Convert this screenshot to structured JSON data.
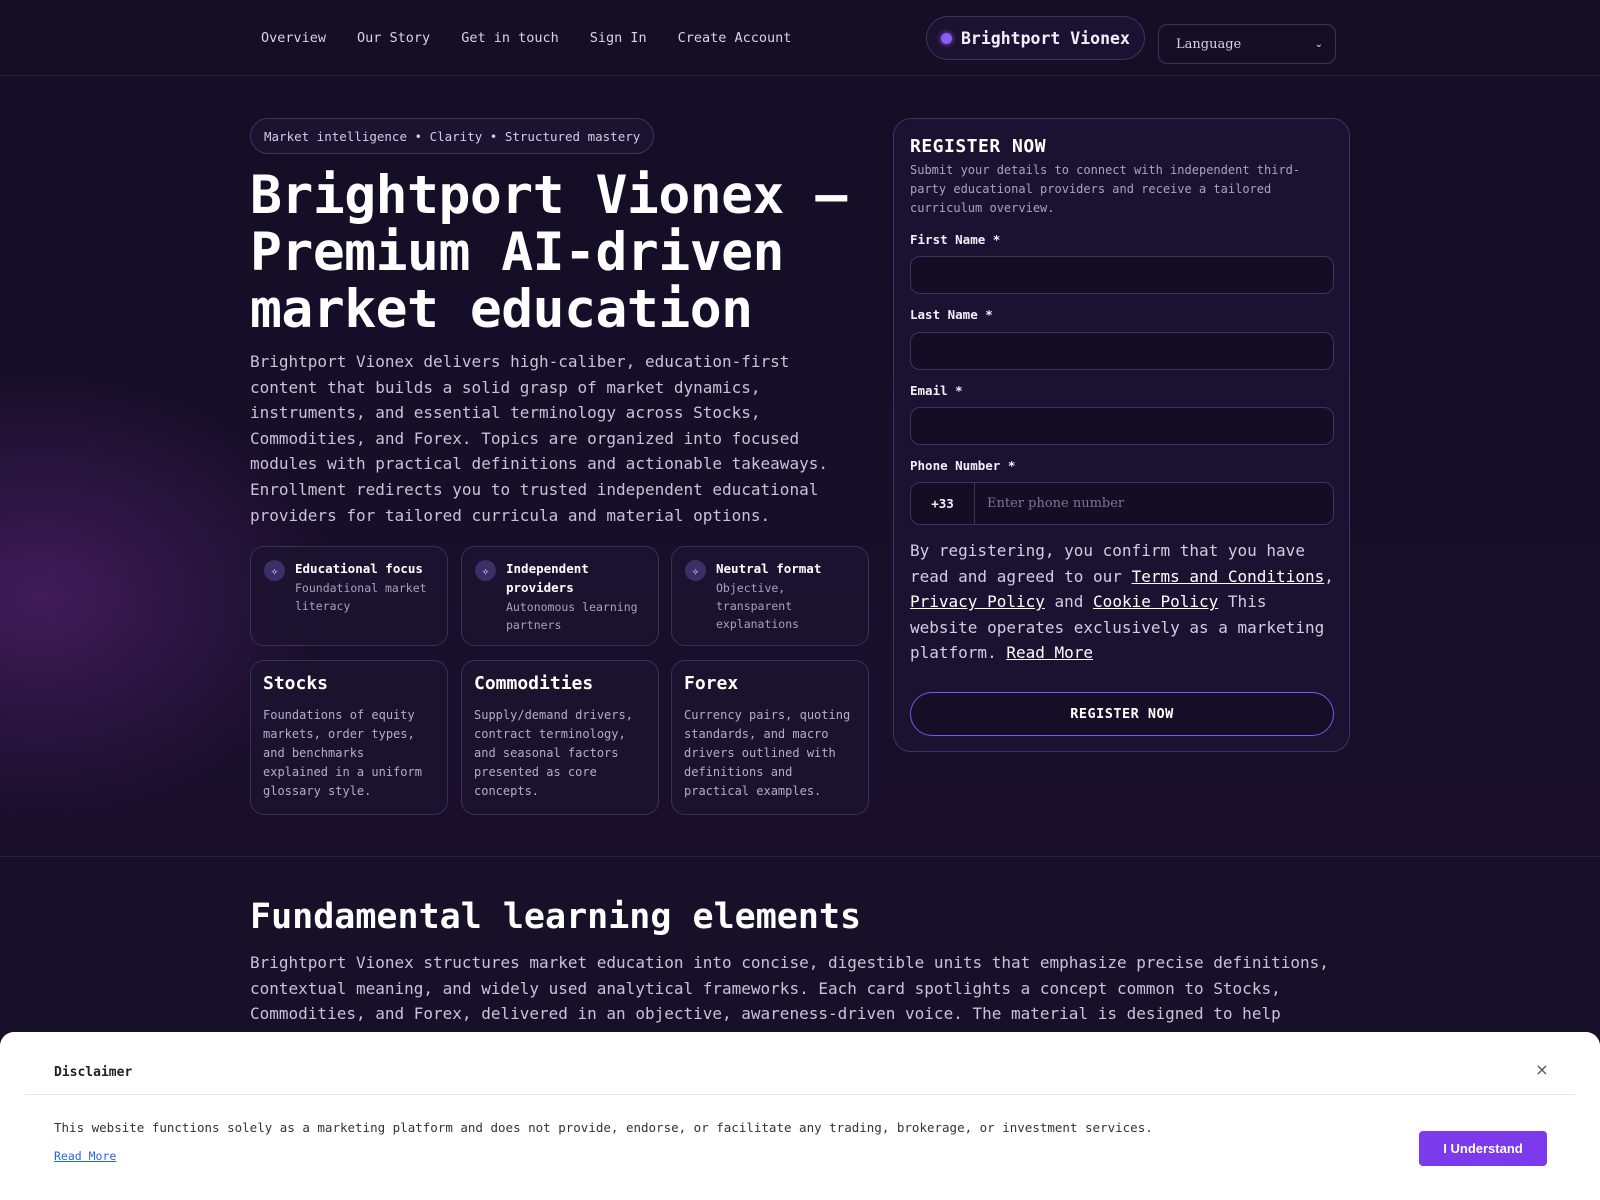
{
  "header": {
    "nav": [
      "Overview",
      "Our Story",
      "Get in touch",
      "Sign In",
      "Create Account"
    ],
    "brand": "Brightport Vionex",
    "language_label": "Language"
  },
  "hero": {
    "tagline": "Market intelligence • Clarity • Structured mastery",
    "title": "Brightport Vionex — Premium AI-driven market education",
    "description": "Brightport Vionex delivers high-caliber, education-first content that builds a solid grasp of market dynamics, instruments, and essential terminology across Stocks, Commodities, and Forex. Topics are organized into focused modules with practical definitions and actionable takeaways. Enrollment redirects you to trusted independent educational providers for tailored curricula and material options.",
    "features": [
      {
        "title": "Educational focus",
        "subtitle": "Foundational market literacy",
        "icon": "sparkle-icon"
      },
      {
        "title": "Independent providers",
        "subtitle": "Autonomous learning partners",
        "icon": "sparkle-icon"
      },
      {
        "title": "Neutral format",
        "subtitle": "Objective, transparent explanations",
        "icon": "sparkle-icon"
      }
    ],
    "topics": [
      {
        "title": "Stocks",
        "description": "Foundations of equity markets, order types, and benchmarks explained in a uniform glossary style."
      },
      {
        "title": "Commodities",
        "description": "Supply/demand drivers, contract terminology, and seasonal factors presented as core concepts."
      },
      {
        "title": "Forex",
        "description": "Currency pairs, quoting standards, and macro drivers outlined with definitions and practical examples."
      }
    ]
  },
  "register": {
    "title": "REGISTER NOW",
    "subtitle": "Submit your details to connect with independent third-party educational providers and receive a tailored curriculum overview.",
    "first_name_label": "First Name *",
    "last_name_label": "Last Name *",
    "email_label": "Email *",
    "phone_label": "Phone Number *",
    "country_code": "+33",
    "phone_placeholder": "Enter phone number",
    "consent": {
      "prefix": "By registering, you confirm that you have read and agreed to our",
      "terms": "Terms and Conditions",
      "comma": ",",
      "privacy": "Privacy Policy",
      "and": "and",
      "cookie": "Cookie Policy",
      "suffix": "This website operates exclusively as a marketing platform.",
      "read_more": "Read More"
    },
    "button": "REGISTER NOW"
  },
  "section2": {
    "title": "Fundamental learning elements",
    "description": "Brightport Vionex structures market education into concise, digestible units that emphasize precise definitions, contextual meaning, and widely used analytical frameworks. Each card spotlights a concept common to Stocks, Commodities, and Forex, delivered in an objective, awareness-driven voice. The material is designed to help"
  },
  "disclaimer": {
    "title": "Disclaimer",
    "close": "×",
    "text": "This website functions solely as a marketing platform and does not provide, endorse, or facilitate any trading, brokerage, or investment services.",
    "read_more": "Read More",
    "button": "I Understand"
  },
  "colors": {
    "background": "#150e24",
    "accent": "#8b5cf6",
    "button": "#7c3aed"
  }
}
